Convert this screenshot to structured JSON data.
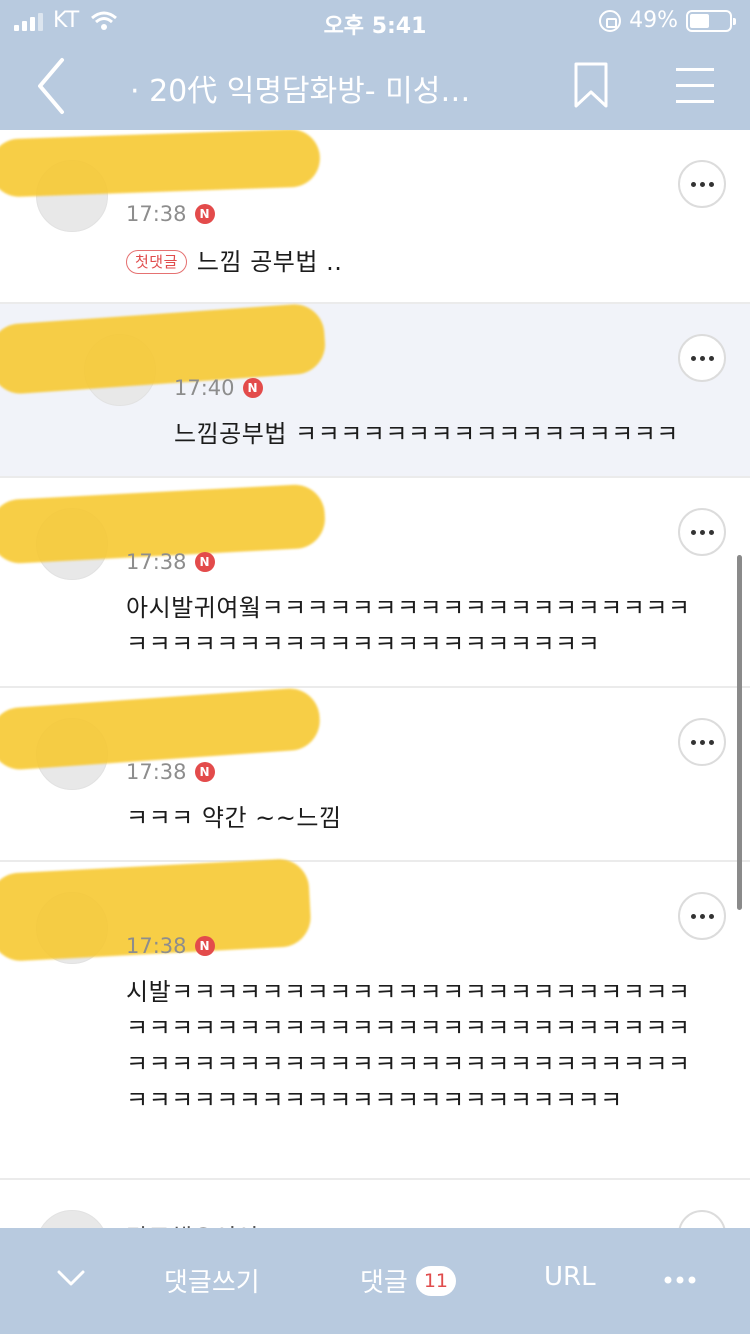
{
  "status_bar": {
    "carrier": "KT",
    "time": "오후 5:41",
    "battery": "49%",
    "battery_level": 0.49
  },
  "nav": {
    "title": "· 20代 익명담화방- 미성…",
    "back_icon": "chevron-left-icon",
    "bookmark_icon": "bookmark-icon",
    "menu_icon": "hamburger-menu-icon"
  },
  "comments": [
    {
      "time": "17:38",
      "badge": "N",
      "tag": "첫댓글",
      "text": "느낌 공부법 .."
    },
    {
      "time": "17:40",
      "badge": "N",
      "text": "느낌공부법 ㅋㅋㅋㅋㅋㅋㅋㅋㅋㅋㅋㅋㅋㅋㅋㅋㅋ"
    },
    {
      "time": "17:38",
      "badge": "N",
      "text": "아시발귀여웤ㅋㅋㅋㅋㅋㅋㅋㅋㅋㅋㅋㅋㅋㅋㅋㅋㅋㅋㅋㅋㅋㅋㅋㅋㅋㅋㅋㅋㅋㅋㅋㅋㅋㅋㅋㅋㅋㅋㅋㅋ"
    },
    {
      "time": "17:38",
      "badge": "N",
      "text": "ㅋㅋㅋ 약간 ~~느낌"
    },
    {
      "time": "17:38",
      "badge": "N",
      "text": "시발ㅋㅋㅋㅋㅋㅋㅋㅋㅋㅋㅋㅋㅋㅋㅋㅋㅋㅋㅋㅋㅋㅋㅋㅋㅋㅋㅋㅋㅋㅋㅋㅋㅋㅋㅋㅋㅋㅋㅋㅋㅋㅋㅋㅋㅋㅋㅋㅋㅋㅋㅋㅋㅋㅋㅋㅋㅋㅋㅋㅋㅋㅋㅋㅋㅋㅋㅋㅋㅋㅋㅋㅋㅋㅋㅋㅋㅋㅋㅋㅋㅋㅋㅋㅋㅋㅋㅋㅋㅋㅋㅋㅋㅋㅋㅋ"
    },
    {
      "nickname": "간로해오이이"
    }
  ],
  "toolbar": {
    "down_icon": "chevron-down-icon",
    "write_label": "댓글쓰기",
    "comments_label": "댓글",
    "comments_count": "11",
    "url_label": "URL",
    "more_icon": "more-horizontal-icon"
  }
}
